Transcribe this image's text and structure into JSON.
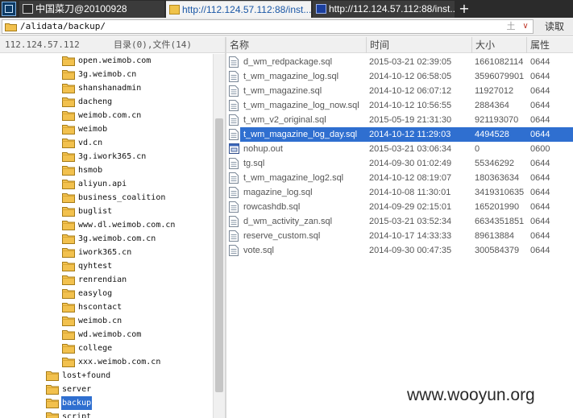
{
  "tabs": [
    {
      "label": "中国菜刀@20100928",
      "active": false
    },
    {
      "label": "http://112.124.57.112:88/inst...",
      "active": true
    },
    {
      "label": "http://112.124.57.112:88/inst...",
      "active": false
    }
  ],
  "tab_add_label": "+",
  "pathbar": {
    "path": "/alidata/backup/",
    "up_glyph": "土",
    "dropdown_glyph": "∨",
    "read_label": "读取"
  },
  "left_panel": {
    "host": "112.124.57.112",
    "summary": "目录(0),文件(14)",
    "tree": [
      {
        "label": "open.weimob.com",
        "level": 2
      },
      {
        "label": "3g.weimob.cn",
        "level": 2
      },
      {
        "label": "shanshanadmin",
        "level": 2
      },
      {
        "label": "dacheng",
        "level": 2
      },
      {
        "label": "weimob.com.cn",
        "level": 2
      },
      {
        "label": "weimob",
        "level": 2
      },
      {
        "label": "vd.cn",
        "level": 2
      },
      {
        "label": "3g.iwork365.cn",
        "level": 2
      },
      {
        "label": "hsmob",
        "level": 2
      },
      {
        "label": "aliyun.api",
        "level": 2
      },
      {
        "label": "business_coalition",
        "level": 2
      },
      {
        "label": "buglist",
        "level": 2
      },
      {
        "label": "www.dl.weimob.com.cn",
        "level": 2
      },
      {
        "label": "3g.weimob.com.cn",
        "level": 2
      },
      {
        "label": "iwork365.cn",
        "level": 2
      },
      {
        "label": "qyhtest",
        "level": 2
      },
      {
        "label": "renrendian",
        "level": 2
      },
      {
        "label": "easylog",
        "level": 2
      },
      {
        "label": "hscontact",
        "level": 2
      },
      {
        "label": "weimob.cn",
        "level": 2
      },
      {
        "label": "wd.weimob.com",
        "level": 2
      },
      {
        "label": "college",
        "level": 2
      },
      {
        "label": "xxx.weimob.com.cn",
        "level": 2
      },
      {
        "label": "lost+found",
        "level": 1
      },
      {
        "label": "server",
        "level": 1
      },
      {
        "label": "backup",
        "level": 1,
        "selected": true
      },
      {
        "label": "script",
        "level": 1
      }
    ]
  },
  "file_list": {
    "columns": {
      "name": "名称",
      "time": "时间",
      "size": "大小",
      "perm": "属性"
    },
    "rows": [
      {
        "name": "d_wm_redpackage.sql",
        "time": "2015-03-21 02:39:05",
        "size": "1661082114",
        "perm": "0644",
        "icon": "sql-file-icon"
      },
      {
        "name": "t_wm_magazine_log.sql",
        "time": "2014-10-12 06:58:05",
        "size": "3596079901",
        "perm": "0644",
        "icon": "sql-file-icon"
      },
      {
        "name": "t_wm_magazine.sql",
        "time": "2014-10-12 06:07:12",
        "size": "11927012",
        "perm": "0644",
        "icon": "sql-file-icon"
      },
      {
        "name": "t_wm_magazine_log_now.sql",
        "time": "2014-10-12 10:56:55",
        "size": "2884364",
        "perm": "0644",
        "icon": "sql-file-icon"
      },
      {
        "name": "t_wm_v2_original.sql",
        "time": "2015-05-19 21:31:30",
        "size": "921193070",
        "perm": "0644",
        "icon": "sql-file-icon"
      },
      {
        "name": "t_wm_magazine_log_day.sql",
        "time": "2014-10-12 11:29:03",
        "size": "4494528",
        "perm": "0644",
        "icon": "sql-file-icon",
        "selected": true
      },
      {
        "name": "nohup.out",
        "time": "2015-03-21 03:06:34",
        "size": "0",
        "perm": "0600",
        "icon": "out-file-icon"
      },
      {
        "name": "tg.sql",
        "time": "2014-09-30 01:02:49",
        "size": "55346292",
        "perm": "0644",
        "icon": "sql-file-icon"
      },
      {
        "name": "t_wm_magazine_log2.sql",
        "time": "2014-10-12 08:19:07",
        "size": "180363634",
        "perm": "0644",
        "icon": "sql-file-icon"
      },
      {
        "name": "magazine_log.sql",
        "time": "2014-10-08 11:30:01",
        "size": "3419310635",
        "perm": "0644",
        "icon": "sql-file-icon"
      },
      {
        "name": "rowcashdb.sql",
        "time": "2014-09-29 02:15:01",
        "size": "165201990",
        "perm": "0644",
        "icon": "sql-file-icon"
      },
      {
        "name": "d_wm_activity_zan.sql",
        "time": "2015-03-21 03:52:34",
        "size": "6634351851",
        "perm": "0644",
        "icon": "sql-file-icon"
      },
      {
        "name": "reserve_custom.sql",
        "time": "2014-10-17 14:33:33",
        "size": "89613884",
        "perm": "0644",
        "icon": "sql-file-icon"
      },
      {
        "name": "vote.sql",
        "time": "2014-09-30 00:47:35",
        "size": "300584379",
        "perm": "0644",
        "icon": "sql-file-icon"
      }
    ]
  },
  "watermark": "www.wooyun.org",
  "colors": {
    "selection": "#2f6fd0",
    "folder": "#f2c14e",
    "tab_bar": "#2b2b2b"
  }
}
